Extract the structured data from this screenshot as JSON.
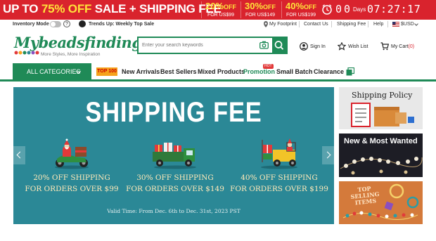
{
  "promo": {
    "headline_pre": "UP TO ",
    "headline_pct": "75% OFF",
    "headline_post": " SALE + SHIPPING FEE",
    "offers": [
      {
        "pct": "20%",
        "off": "OFF",
        "for": "FOR US$99"
      },
      {
        "pct": "30%",
        "off": "OFF",
        "for": "FOR US$149"
      },
      {
        "pct": "40%",
        "off": "OFF",
        "for": "FOR US$199"
      }
    ],
    "countdown": {
      "d1": "0",
      "d2": "0",
      "days_label": "Days",
      "time": "07:27:17"
    },
    "colors": {
      "bg": "#d9232d",
      "highlight": "#ffe23a"
    }
  },
  "utility": {
    "inventory_mode": "Inventory Mode",
    "help": "?",
    "trends": "Trends Up: Weekly Top Sale",
    "links": [
      "My Footprint",
      "Contact Us",
      "Shipping Fee",
      "Help"
    ],
    "currency": "$USD"
  },
  "header": {
    "logo": "Mybeadsfindings",
    "tagline": "More Styles, More Inspiration",
    "search_placeholder": "Enter your search keywords",
    "sign_in": "Sign In",
    "wish_list": "Wish List",
    "cart": "My Cart",
    "cart_count": "(0)",
    "brand_color": "#1f8a57"
  },
  "nav": {
    "all_categories": "ALL CATEGORIES",
    "top100": "TOP 100",
    "items": [
      "New Arrivals",
      "Best Sellers",
      "Mixed Products",
      "Promotion",
      "Small Batch",
      "Clearance"
    ],
    "hot": "HOT"
  },
  "hero": {
    "title": "SHIPPING FEE",
    "tiers": [
      {
        "line1": "20% OFF SHIPPING",
        "line2": "FOR ORDERS OVER $99"
      },
      {
        "line1": "30% OFF SHIPPING",
        "line2": "FOR ORDERS OVER $149"
      },
      {
        "line1": "40% OFF SHIPPING",
        "line2": "FOR ORDERS OVER $199"
      }
    ],
    "valid": "Valid Time: From Dec. 6th to Dec. 31st, 2023 PST",
    "bg": "#2b8896"
  },
  "tiles": {
    "shipping_policy": "Shipping Policy",
    "new_wanted": "New & Most Wanted",
    "top_selling": "TOP SELLING ITEMS"
  }
}
